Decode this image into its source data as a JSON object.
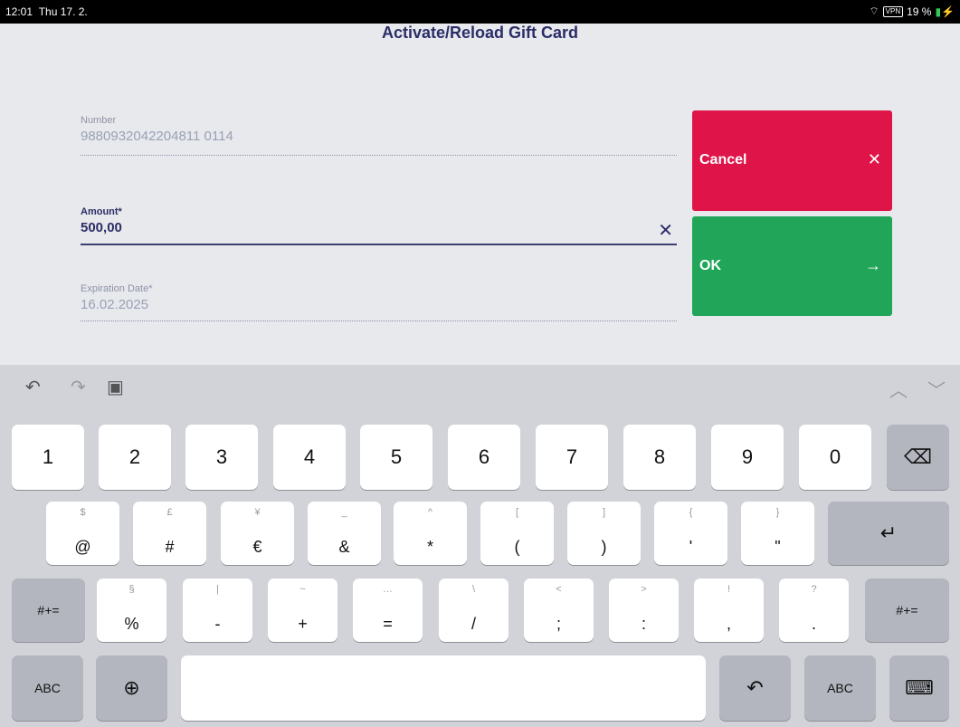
{
  "status": {
    "time": "12:01",
    "date": "Thu 17. 2.",
    "vpn": "VPN",
    "battery": "19 %"
  },
  "app": {
    "title": "Activate/Reload Gift Card",
    "number": {
      "label": "Number",
      "value": "9880932042204811 0114"
    },
    "amount": {
      "label": "Amount*",
      "value": "500,00"
    },
    "expiration": {
      "label": "Expiration Date*",
      "value": "16.02.2025"
    },
    "cancel_label": "Cancel",
    "ok_label": "OK"
  },
  "keyboard": {
    "row1": [
      "1",
      "2",
      "3",
      "4",
      "5",
      "6",
      "7",
      "8",
      "9",
      "0"
    ],
    "row2": [
      {
        "sec": "$",
        "pri": "@"
      },
      {
        "sec": "£",
        "pri": "#"
      },
      {
        "sec": "¥",
        "pri": "€"
      },
      {
        "sec": "_",
        "pri": "&"
      },
      {
        "sec": "^",
        "pri": "*"
      },
      {
        "sec": "[",
        "pri": "("
      },
      {
        "sec": "]",
        "pri": ")"
      },
      {
        "sec": "{",
        "pri": "'"
      },
      {
        "sec": "}",
        "pri": "\""
      }
    ],
    "row3": [
      {
        "sec": "§",
        "pri": "%"
      },
      {
        "sec": "|",
        "pri": "-"
      },
      {
        "sec": "~",
        "pri": "+"
      },
      {
        "sec": "…",
        "pri": "="
      },
      {
        "sec": "\\",
        "pri": "/"
      },
      {
        "sec": "<",
        "pri": ";"
      },
      {
        "sec": ">",
        "pri": ":"
      },
      {
        "sec": "!",
        "pri": ","
      },
      {
        "sec": "?",
        "pri": "."
      }
    ],
    "mode_label": "#+=",
    "abc_label": "ABC"
  }
}
